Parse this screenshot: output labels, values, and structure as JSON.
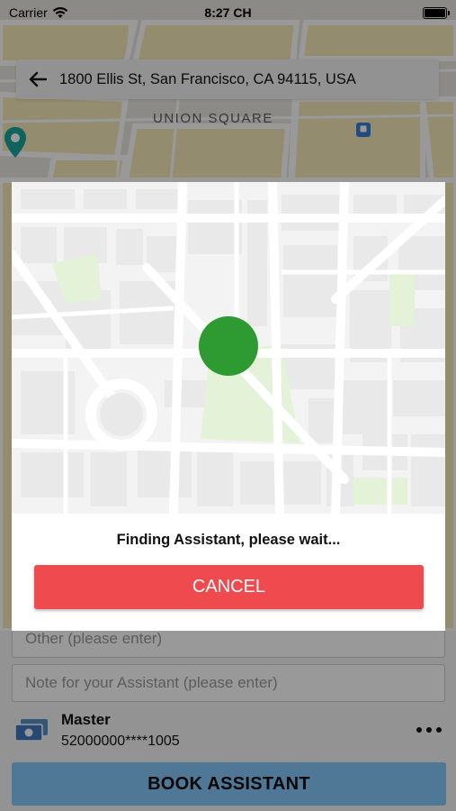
{
  "status_bar": {
    "carrier": "Carrier",
    "time": "8:27 CH",
    "icons": [
      "wifi-icon",
      "battery-icon"
    ]
  },
  "address_bar": {
    "back_icon": "arrow-left-icon",
    "address": "1800 Ellis St, San Francisco, CA 94115, USA"
  },
  "map": {
    "area_label": "UNION SQUARE",
    "poi_icons": [
      "map-pin-icon",
      "transit-icon"
    ]
  },
  "form": {
    "other_placeholder": "Other (please enter)",
    "note_placeholder": "Note for your Assistant (please enter)",
    "payment": {
      "icon": "money-icon",
      "card_name": "Master",
      "card_number": "52000000****1005",
      "more_icon": "more-icon"
    },
    "book_label": "BOOK ASSISTANT"
  },
  "modal": {
    "message": "Finding Assistant, please wait...",
    "cancel_label": "CANCEL"
  },
  "colors": {
    "cancel": "#ef4a4e",
    "book": "#84c8fa",
    "searching_dot": "#2e9a32"
  }
}
